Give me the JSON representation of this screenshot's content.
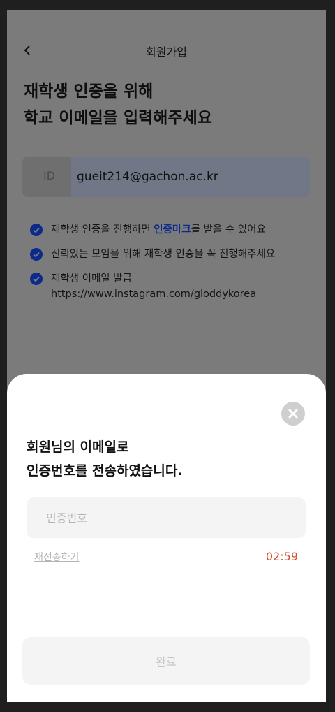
{
  "header": {
    "title": "회원가입"
  },
  "headline": {
    "line1": "재학생 인증을 위해",
    "line2": "학교 이메일을 입력해주세요"
  },
  "email": {
    "prefix": "ID",
    "value": "gueit214@gachon.ac.kr"
  },
  "checks": {
    "item1_before": "재학생 인증을 진행하면 ",
    "item1_highlight": "인증마크",
    "item1_after": "를 받을 수 있어요",
    "item2": "신뢰있는 모임을 위해 재학생 인증을 꼭 진행해주세요",
    "item3_line1": "재학생 이메일 발급",
    "item3_line2": "https://www.instagram.com/gloddykorea"
  },
  "sheet": {
    "title_line1": "회원님의 이메일로",
    "title_line2": "인증번호를 전송하였습니다.",
    "code_placeholder": "인증번호",
    "resend_label": "재전송하기",
    "timer": "02:59",
    "done_label": "완료"
  },
  "colors": {
    "dim_overlay": "#7b7b7b",
    "check_icon": "#0b2a8a",
    "highlight": "#0a2a8c",
    "timer": "#d44a2c",
    "sheet_bg": "#ffffff"
  },
  "icons": {
    "back": "chevron-left-icon",
    "check": "check-circle-icon",
    "close": "close-circle-icon"
  }
}
